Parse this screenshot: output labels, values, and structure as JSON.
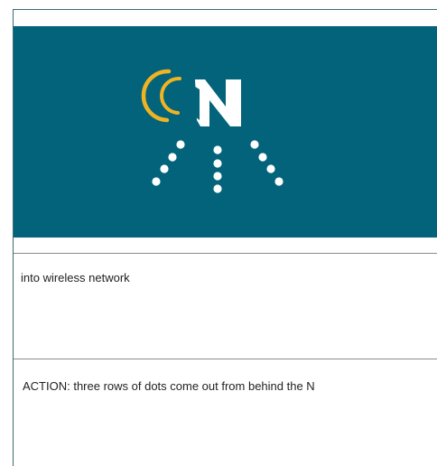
{
  "frame": {
    "background_color": "#02637a",
    "logo": {
      "letter": "N",
      "letter_color": "#ffffff",
      "signal_arcs_color": "#f0b323",
      "dots_color": "#ffffff"
    }
  },
  "captions": {
    "description": "into wireless network",
    "action": "ACTION: three rows of dots come out from behind the N"
  }
}
